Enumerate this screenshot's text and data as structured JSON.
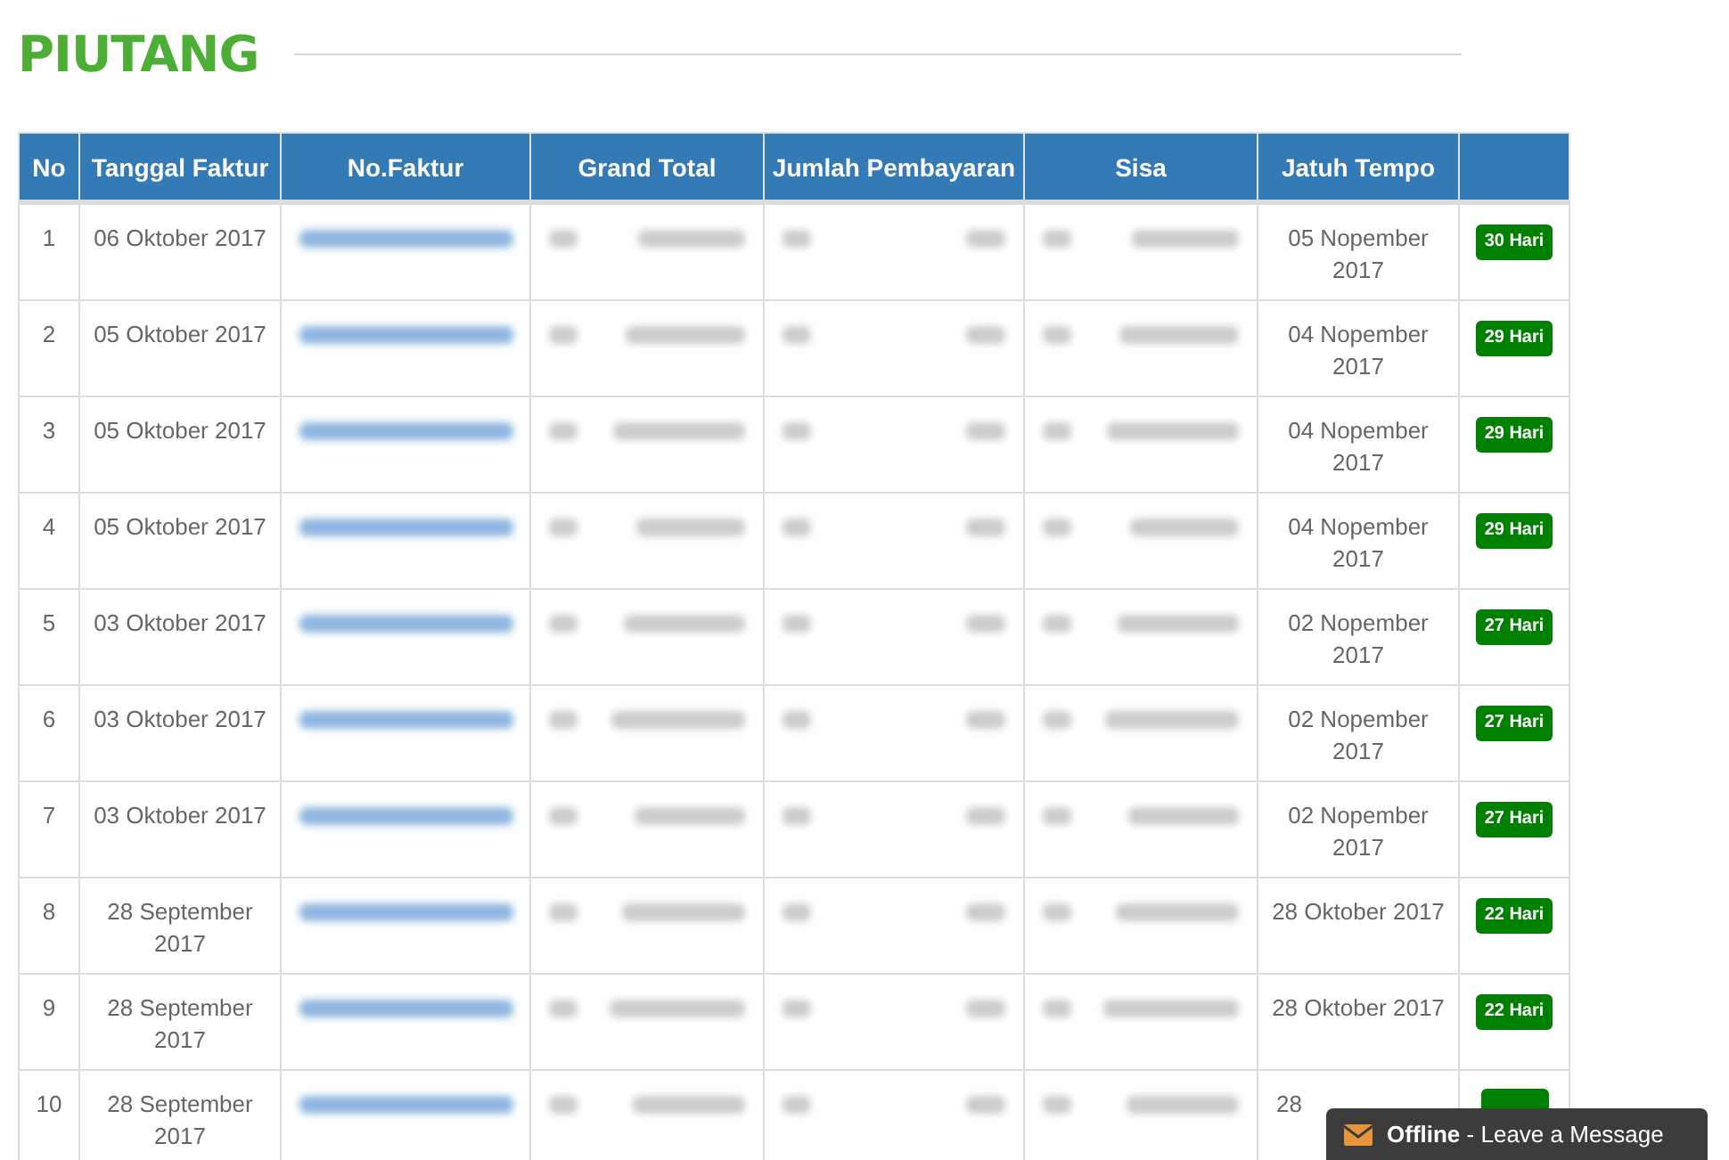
{
  "title": "PIUTANG",
  "table": {
    "columns": [
      "No",
      "Tanggal Faktur",
      "No.Faktur",
      "Grand Total",
      "Jumlah Pembayaran",
      "Sisa",
      "Jatuh Tempo"
    ],
    "rows": [
      {
        "no": "1",
        "tanggal": "06 Oktober 2017",
        "jatuh_tempo": "05 Nopember 2017",
        "sisa_hari": "30 Hari"
      },
      {
        "no": "2",
        "tanggal": "05 Oktober 2017",
        "jatuh_tempo": "04 Nopember 2017",
        "sisa_hari": "29 Hari"
      },
      {
        "no": "3",
        "tanggal": "05 Oktober 2017",
        "jatuh_tempo": "04 Nopember 2017",
        "sisa_hari": "29 Hari"
      },
      {
        "no": "4",
        "tanggal": "05 Oktober 2017",
        "jatuh_tempo": "04 Nopember 2017",
        "sisa_hari": "29 Hari"
      },
      {
        "no": "5",
        "tanggal": "03 Oktober 2017",
        "jatuh_tempo": "02 Nopember 2017",
        "sisa_hari": "27 Hari"
      },
      {
        "no": "6",
        "tanggal": "03 Oktober 2017",
        "jatuh_tempo": "02 Nopember 2017",
        "sisa_hari": "27 Hari"
      },
      {
        "no": "7",
        "tanggal": "03 Oktober 2017",
        "jatuh_tempo": "02 Nopember 2017",
        "sisa_hari": "27 Hari"
      },
      {
        "no": "8",
        "tanggal": "28 September 2017",
        "jatuh_tempo": "28 Oktober 2017",
        "sisa_hari": "22 Hari"
      },
      {
        "no": "9",
        "tanggal": "28 September 2017",
        "jatuh_tempo": "28 Oktober 2017",
        "sisa_hari": "22 Hari"
      },
      {
        "no": "10",
        "tanggal": "28 September 2017",
        "jatuh_tempo": "28"
      }
    ]
  },
  "chat_widget": {
    "status": "Offline",
    "message": "- Leave a Message"
  }
}
